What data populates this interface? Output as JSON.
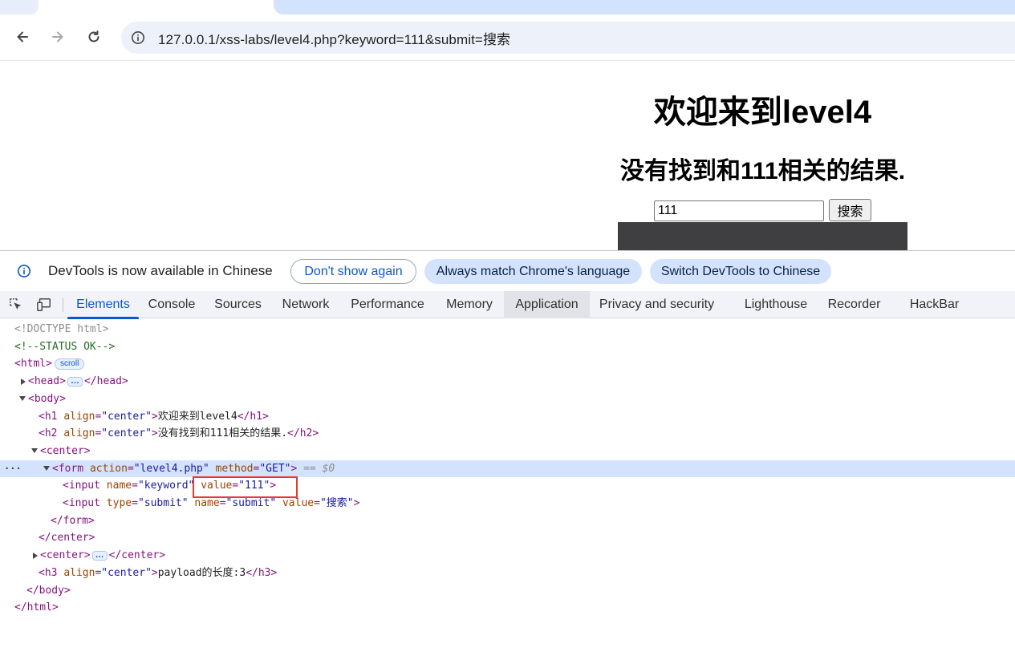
{
  "browser": {
    "url": "127.0.0.1/xss-labs/level4.php?keyword=111&submit=搜索"
  },
  "page": {
    "heading": "欢迎来到level4",
    "subheading": "没有找到和111相关的结果.",
    "search_value": "111",
    "search_button": "搜索",
    "dark_box_color": "#3f3f42"
  },
  "infobar": {
    "message": "DevTools is now available in Chinese",
    "dont_show": "Don't show again",
    "always_match": "Always match Chrome's language",
    "switch": "Switch DevTools to Chinese"
  },
  "devtools": {
    "tabs": [
      "Elements",
      "Console",
      "Sources",
      "Network",
      "Performance",
      "Memory",
      "Application",
      "Privacy and security",
      "Lighthouse",
      "Recorder",
      "HackBar"
    ],
    "active_tab": "Elements",
    "accent": "#0b57d0"
  },
  "tree": {
    "doctype": "<!DOCTYPE html>",
    "comment": "<!--STATUS OK-->",
    "scroll_badge": "scroll",
    "ellipsis": "…",
    "h1_text": "欢迎来到level4",
    "h2_text": "没有找到和111相关的结果.",
    "center_attr_value": "\"center\"",
    "form_action": "\"level4.php\"",
    "form_method": "\"GET\"",
    "dollar0": "== $0",
    "input_name": "\"keyword\"",
    "input_value": "\"111\"",
    "submit_type": "\"submit\"",
    "submit_name": "\"submit\"",
    "submit_value": "\"搜索\"",
    "h3_text": "payload的长度:3"
  }
}
